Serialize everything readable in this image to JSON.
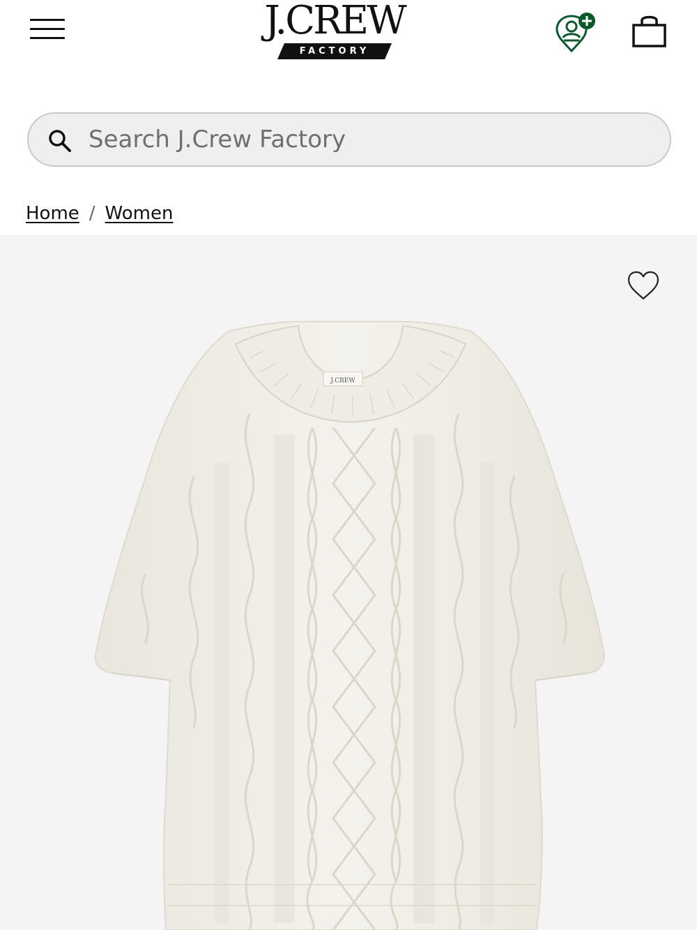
{
  "header": {
    "brand_name": "J.CREW",
    "brand_sub": "FACTORY",
    "menu_icon": "hamburger-menu-icon",
    "account_icon": "rewards-account-icon",
    "bag_icon": "shopping-bag-icon",
    "accent_color": "#0c5a2c"
  },
  "search": {
    "placeholder": "Search J.Crew Factory",
    "value": "",
    "icon": "search-icon"
  },
  "breadcrumb": {
    "items": [
      {
        "label": "Home"
      },
      {
        "label": "Women"
      }
    ],
    "separator": "/"
  },
  "product": {
    "image_label": "J.CREW",
    "wishlist_icon": "heart-outline-icon",
    "sweater_color": "#f2f0e9"
  }
}
